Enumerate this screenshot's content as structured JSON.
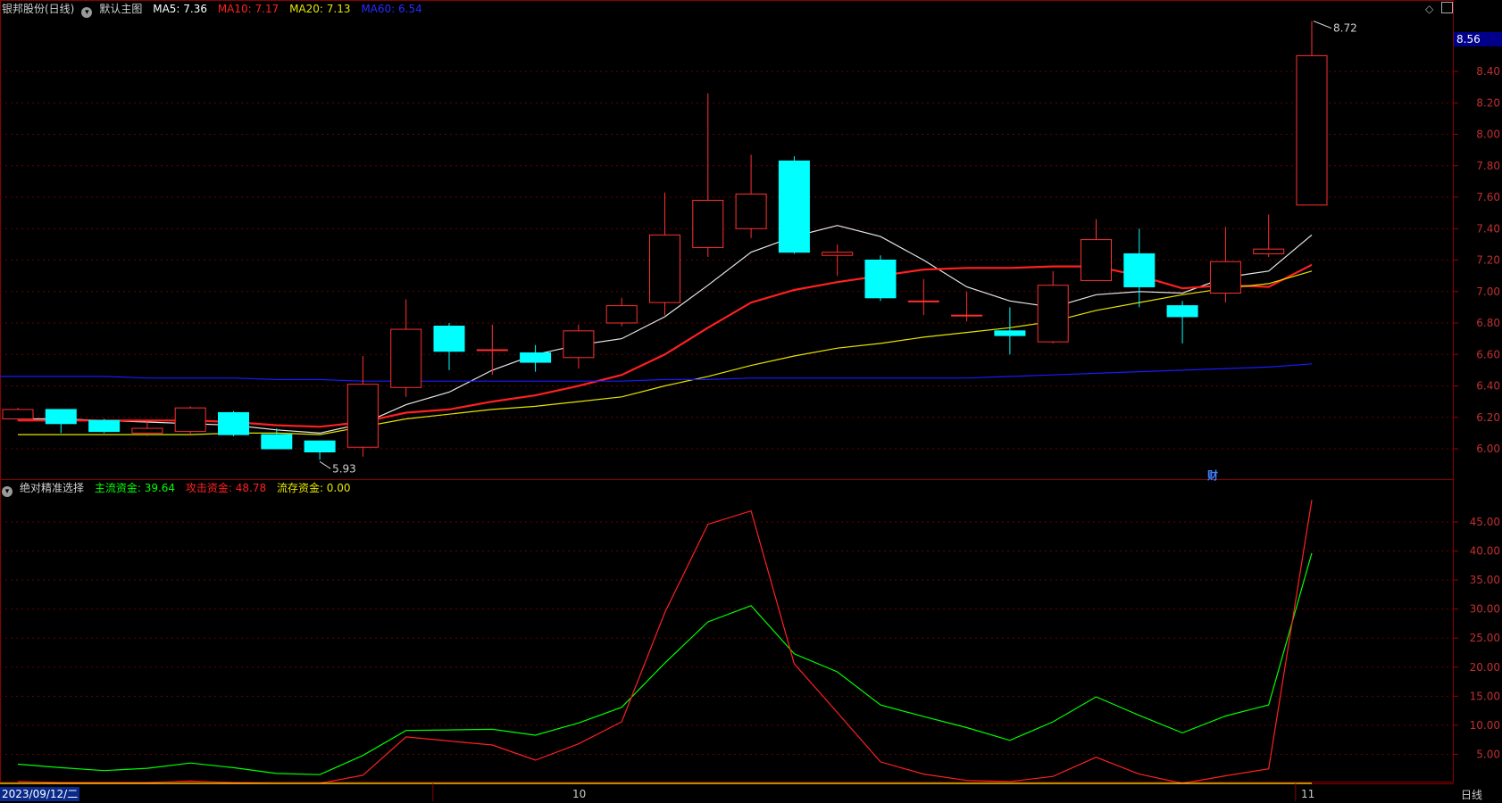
{
  "header": {
    "stock": "银邦股份(日线)",
    "template": "默认主图",
    "ma5": "MA5: 7.36",
    "ma10": "MA10: 7.17",
    "ma20": "MA20: 7.13",
    "ma60": "MA60: 6.54",
    "colors": {
      "ma5": "#ffffff",
      "ma10": "#ff2020",
      "ma20": "#e6e600",
      "ma60": "#1a1aff"
    }
  },
  "sub_header": {
    "indicator": "绝对精准选择",
    "main_funds": "主流资金: 39.64",
    "attack_funds": "攻击资金: 48.78",
    "stock_funds": "流存资金: 0.00",
    "colors": {
      "main": "#00ff00",
      "attack": "#ff2020",
      "stock": "#e6e600"
    }
  },
  "labels": {
    "high_label": "8.72",
    "low_label": "5.93",
    "current_price": "8.56",
    "fin_marker": "财",
    "date_start": "2023/09/12/二",
    "month_10": "10",
    "month_11": "11",
    "period": "日线"
  },
  "chart_data": [
    {
      "type": "candlestick",
      "title": "银邦股份(日线)",
      "ylim": [
        5.85,
        8.75
      ],
      "y_ticks": [
        "6.00",
        "6.20",
        "6.40",
        "6.60",
        "6.80",
        "7.00",
        "7.20",
        "7.40",
        "7.60",
        "7.80",
        "8.00",
        "8.20",
        "8.40"
      ],
      "candles": [
        {
          "o": 6.19,
          "c": 6.25,
          "h": 6.26,
          "l": 6.18
        },
        {
          "o": 6.25,
          "c": 6.16,
          "h": 6.25,
          "l": 6.1
        },
        {
          "o": 6.18,
          "c": 6.11,
          "h": 6.19,
          "l": 6.1
        },
        {
          "o": 6.1,
          "c": 6.13,
          "h": 6.18,
          "l": 6.08
        },
        {
          "o": 6.11,
          "c": 6.26,
          "h": 6.27,
          "l": 6.09
        },
        {
          "o": 6.23,
          "c": 6.09,
          "h": 6.24,
          "l": 6.08
        },
        {
          "o": 6.09,
          "c": 6.0,
          "h": 6.13,
          "l": 6.0
        },
        {
          "o": 6.05,
          "c": 5.98,
          "h": 6.05,
          "l": 5.93
        },
        {
          "o": 6.01,
          "c": 6.41,
          "h": 6.59,
          "l": 5.95
        },
        {
          "o": 6.39,
          "c": 6.76,
          "h": 6.95,
          "l": 6.33
        },
        {
          "o": 6.78,
          "c": 6.62,
          "h": 6.8,
          "l": 6.5
        },
        {
          "o": 6.63,
          "c": 6.63,
          "h": 6.79,
          "l": 6.47
        },
        {
          "o": 6.61,
          "c": 6.55,
          "h": 6.66,
          "l": 6.49
        },
        {
          "o": 6.58,
          "c": 6.75,
          "h": 6.79,
          "l": 6.51
        },
        {
          "o": 6.8,
          "c": 6.91,
          "h": 6.96,
          "l": 6.78
        },
        {
          "o": 6.93,
          "c": 7.36,
          "h": 7.63,
          "l": 6.85
        },
        {
          "o": 7.28,
          "c": 7.58,
          "h": 8.26,
          "l": 7.22
        },
        {
          "o": 7.4,
          "c": 7.62,
          "h": 7.87,
          "l": 7.34
        },
        {
          "o": 7.83,
          "c": 7.25,
          "h": 7.86,
          "l": 7.24
        },
        {
          "o": 7.23,
          "c": 7.25,
          "h": 7.3,
          "l": 7.1
        },
        {
          "o": 7.2,
          "c": 6.96,
          "h": 7.23,
          "l": 6.94
        },
        {
          "o": 6.94,
          "c": 6.94,
          "h": 7.08,
          "l": 6.85
        },
        {
          "o": 6.85,
          "c": 6.85,
          "h": 7.0,
          "l": 6.81
        },
        {
          "o": 6.75,
          "c": 6.72,
          "h": 6.9,
          "l": 6.6
        },
        {
          "o": 6.68,
          "c": 7.04,
          "h": 7.13,
          "l": 6.67
        },
        {
          "o": 7.07,
          "c": 7.33,
          "h": 7.46,
          "l": 7.07
        },
        {
          "o": 7.24,
          "c": 7.03,
          "h": 7.4,
          "l": 6.9
        },
        {
          "o": 6.91,
          "c": 6.84,
          "h": 6.94,
          "l": 6.67
        },
        {
          "o": 6.99,
          "c": 7.19,
          "h": 7.41,
          "l": 6.93
        },
        {
          "o": 7.24,
          "c": 7.27,
          "h": 7.49,
          "l": 7.22
        },
        {
          "o": 7.55,
          "c": 8.5,
          "h": 8.72,
          "l": 7.55
        }
      ],
      "series": [
        {
          "name": "MA5",
          "values": [
            6.19,
            6.19,
            6.18,
            6.17,
            6.16,
            6.15,
            6.12,
            6.1,
            6.16,
            6.28,
            6.36,
            6.5,
            6.6,
            6.66,
            6.7,
            6.84,
            7.04,
            7.25,
            7.35,
            7.42,
            7.35,
            7.2,
            7.03,
            6.94,
            6.9,
            6.98,
            7.0,
            6.99,
            7.09,
            7.13,
            7.36
          ]
        },
        {
          "name": "MA10",
          "values": [
            6.18,
            6.18,
            6.18,
            6.18,
            6.18,
            6.17,
            6.15,
            6.14,
            6.17,
            6.23,
            6.25,
            6.3,
            6.34,
            6.4,
            6.47,
            6.6,
            6.77,
            6.93,
            7.01,
            7.06,
            7.1,
            7.14,
            7.15,
            7.15,
            7.16,
            7.16,
            7.1,
            7.02,
            7.04,
            7.03,
            7.17
          ]
        },
        {
          "name": "MA20",
          "values": [
            6.09,
            6.09,
            6.09,
            6.09,
            6.09,
            6.1,
            6.1,
            6.09,
            6.14,
            6.19,
            6.22,
            6.25,
            6.27,
            6.3,
            6.33,
            6.4,
            6.46,
            6.53,
            6.59,
            6.64,
            6.67,
            6.71,
            6.74,
            6.77,
            6.81,
            6.88,
            6.93,
            6.98,
            7.02,
            7.05,
            7.13
          ]
        },
        {
          "name": "MA60",
          "values": [
            6.46,
            6.46,
            6.46,
            6.45,
            6.45,
            6.45,
            6.44,
            6.44,
            6.43,
            6.43,
            6.43,
            6.43,
            6.43,
            6.43,
            6.43,
            6.44,
            6.44,
            6.45,
            6.45,
            6.45,
            6.45,
            6.45,
            6.45,
            6.46,
            6.47,
            6.48,
            6.49,
            6.5,
            6.51,
            6.52,
            6.54
          ]
        }
      ]
    },
    {
      "type": "line",
      "title": "绝对精准选择",
      "ylim": [
        0,
        49.5
      ],
      "y_ticks": [
        "5.00",
        "10.00",
        "15.00",
        "20.00",
        "25.00",
        "30.00",
        "35.00",
        "40.00",
        "45.00"
      ],
      "series": [
        {
          "name": "主流资金",
          "values": [
            3.3,
            2.7,
            2.2,
            2.6,
            3.5,
            2.7,
            1.7,
            1.5,
            4.8,
            9.1,
            9.2,
            9.3,
            8.3,
            10.4,
            13.1,
            20.7,
            27.8,
            30.6,
            22.3,
            19.2,
            13.5,
            11.5,
            9.6,
            7.4,
            10.6,
            14.9,
            11.7,
            8.7,
            11.6,
            13.5,
            39.64
          ]
        },
        {
          "name": "攻击资金",
          "values": [
            0.3,
            0.1,
            0.1,
            0.1,
            0.4,
            0.1,
            0.0,
            0.0,
            1.4,
            8.0,
            7.3,
            6.6,
            4.0,
            6.8,
            10.6,
            29.4,
            44.6,
            46.9,
            20.6,
            12.2,
            3.7,
            1.6,
            0.5,
            0.3,
            1.2,
            4.5,
            1.6,
            0.0,
            1.3,
            2.5,
            48.78
          ]
        },
        {
          "name": "流存资金",
          "values": [
            0,
            0,
            0,
            0,
            0,
            0,
            0,
            0,
            0,
            0,
            0,
            0,
            0,
            0,
            0,
            0,
            0,
            0,
            0,
            0,
            0,
            0,
            0,
            0,
            0,
            0,
            0,
            0,
            0,
            0,
            0
          ]
        }
      ]
    }
  ]
}
